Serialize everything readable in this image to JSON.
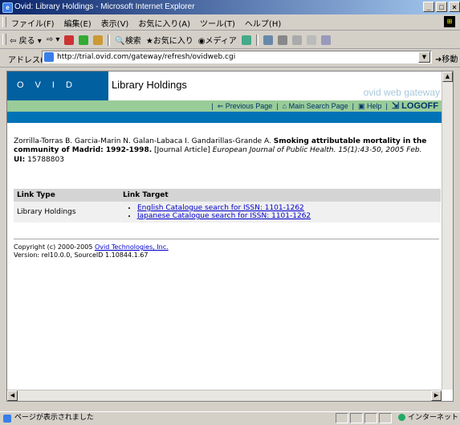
{
  "window": {
    "title": "Ovid: Library Holdings - Microsoft Internet Explorer"
  },
  "menu": [
    "ファイル(F)",
    "編集(E)",
    "表示(V)",
    "お気に入り(A)",
    "ツール(T)",
    "ヘルプ(H)"
  ],
  "toolbar": {
    "back": "戻る",
    "search": "検索",
    "favorites": "お気に入り",
    "media": "メディア"
  },
  "address": {
    "label": "アドレス(D)",
    "url": "http://trial.ovid.com/gateway/refresh/ovidweb.cgi",
    "go": "移動"
  },
  "header": {
    "logo": "OVID",
    "title": "Library Holdings",
    "gateway": "ovid web gateway"
  },
  "nav": {
    "previous": "Previous Page",
    "main_search": "Main Search Page",
    "help": "Help",
    "logoff": "LOGOFF"
  },
  "citation": {
    "authors": "Zorrilla-Torras B. Garcia-Marin N. Galan-Labaca I. Gandarillas-Grande A.",
    "title": "Smoking attributable mortality in the community of Madrid: 1992-1998.",
    "type": "[Journal Article]",
    "journal": "European Journal of Public Health. 15(1):43-50, 2005 Feb.",
    "ui_label": "UI:",
    "ui_value": "15788803"
  },
  "table": {
    "headers": [
      "Link Type",
      "Link Target"
    ],
    "row_type": "Library Holdings",
    "targets": [
      "English Catalogue search for ISSN: 1101-1262",
      "Japanese Catalogue search for ISSN: 1101-1262"
    ]
  },
  "footer": {
    "copyright": "Copyright (c) 2000-2005",
    "company": "Ovid Technologies, Inc.",
    "version": "Version: rel10.0.0, SourceID 1.10844.1.67"
  },
  "status": {
    "message": "ページが表示されました",
    "zone": "インターネット"
  },
  "colors": {
    "ovid_blue": "#0060a0",
    "nav_green": "#99cc99",
    "link": "#0000cc"
  }
}
